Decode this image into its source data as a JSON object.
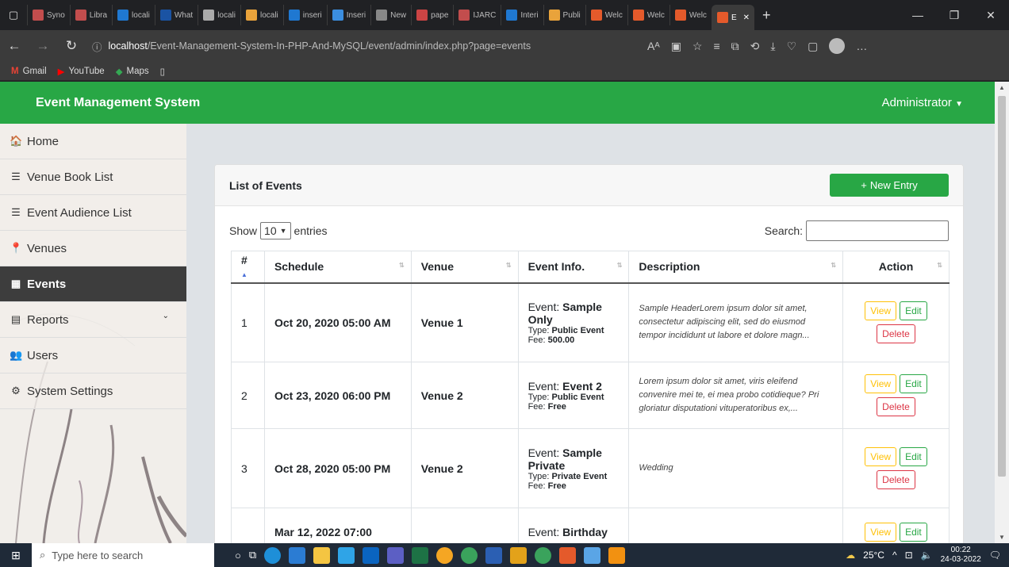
{
  "browser": {
    "tabs": [
      {
        "label": "Syno",
        "color": "#c24d4d"
      },
      {
        "label": "Libra",
        "color": "#c24d4d"
      },
      {
        "label": "locali",
        "color": "#1f78d1"
      },
      {
        "label": "What",
        "color": "#1a53a3"
      },
      {
        "label": "locali",
        "color": "#aaaaaa"
      },
      {
        "label": "locali",
        "color": "#e9a33b"
      },
      {
        "label": "inseri",
        "color": "#1f78d1"
      },
      {
        "label": "Inseri",
        "color": "#3b8ee0"
      },
      {
        "label": "New",
        "color": "#888888"
      },
      {
        "label": "pape",
        "color": "#c44"
      },
      {
        "label": "IJARC",
        "color": "#c24d4d"
      },
      {
        "label": "Interi",
        "color": "#1f78d1"
      },
      {
        "label": "Publi",
        "color": "#e9a33b"
      },
      {
        "label": "Welc",
        "color": "#e45a2b"
      },
      {
        "label": "Welc",
        "color": "#e45a2b"
      },
      {
        "label": "Welc",
        "color": "#e45a2b"
      }
    ],
    "active_tab": {
      "label": "E",
      "close": "✕"
    },
    "new_tab": "+",
    "url_host": "localhost",
    "url_path": "/Event-Management-System-In-PHP-And-MySQL/event/admin/index.php?page=events",
    "bookmarks": [
      {
        "label": "Gmail",
        "icon": "gmail-icon"
      },
      {
        "label": "YouTube",
        "icon": "youtube-icon"
      },
      {
        "label": "Maps",
        "icon": "maps-icon"
      }
    ]
  },
  "app": {
    "brand": "Event Management System",
    "user": "Administrator",
    "sidebar": [
      {
        "label": "Home",
        "icon": "home-icon",
        "glyph": "🏠"
      },
      {
        "label": "Venue Book List",
        "icon": "list-icon",
        "glyph": "☰"
      },
      {
        "label": "Event Audience List",
        "icon": "list-icon",
        "glyph": "☰"
      },
      {
        "label": "Venues",
        "icon": "map-marker-icon",
        "glyph": "📍"
      },
      {
        "label": "Events",
        "icon": "calendar-icon",
        "glyph": "▦",
        "active": true
      },
      {
        "label": "Reports",
        "icon": "file-icon",
        "glyph": "▤"
      },
      {
        "label": "Users",
        "icon": "users-icon",
        "glyph": "👥"
      },
      {
        "label": "System Settings",
        "icon": "cogs-icon",
        "glyph": "⚙"
      }
    ]
  },
  "events_card": {
    "title": "List of Events",
    "new_entry": "New Entry",
    "show_label": "Show",
    "entries_value": "10",
    "entries_label": "entries",
    "search_label": "Search:",
    "columns": [
      "#",
      "Schedule",
      "Venue",
      "Event Info.",
      "Description",
      "Action"
    ],
    "event_label": "Event:",
    "type_label": "Type:",
    "fee_label": "Fee:",
    "view_label": "View",
    "edit_label": "Edit",
    "delete_label": "Delete",
    "rows": [
      {
        "num": "1",
        "schedule": "Oct 20, 2020 05:00 AM",
        "venue": "Venue 1",
        "event": "Sample Only",
        "type": "Public Event",
        "fee": "500.00",
        "description": "Sample HeaderLorem ipsum dolor sit amet, consectetur adipiscing elit, sed do eiusmod tempor incididunt ut labore et dolore magn..."
      },
      {
        "num": "2",
        "schedule": "Oct 23, 2020 06:00 PM",
        "venue": "Venue 2",
        "event": "Event 2",
        "type": "Public Event",
        "fee": "Free",
        "description": "Lorem ipsum dolor sit amet, viris eleifend convenire mei te, ei mea probo cotidieque? Pri gloriatur disputationi vituperatoribus ex,..."
      },
      {
        "num": "3",
        "schedule": "Oct 28, 2020 05:00 PM",
        "venue": "Venue 2",
        "event": "Sample Private",
        "type": "Private Event",
        "fee": "Free",
        "description": "Wedding"
      },
      {
        "num": "",
        "schedule": "Mar 12, 2022 07:00",
        "venue": "",
        "event": "Birthday",
        "type": "",
        "fee": "",
        "description": ""
      }
    ]
  },
  "taskbar": {
    "search_placeholder": "Type here to search",
    "weather": "25°C",
    "time": "00:22",
    "date": "24-03-2022"
  }
}
